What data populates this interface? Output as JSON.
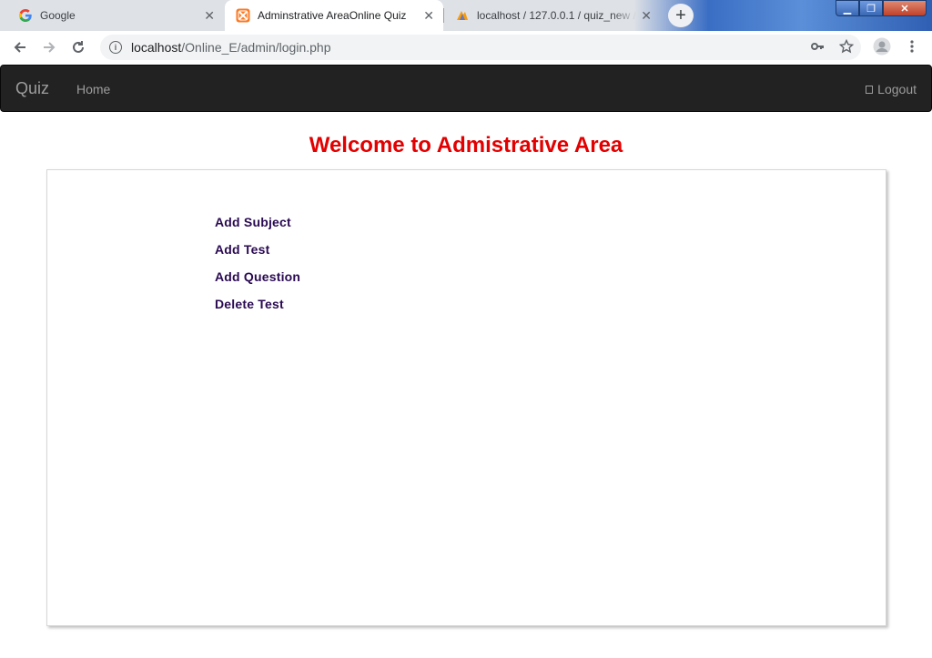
{
  "browser": {
    "tabs": [
      {
        "title": "Google",
        "icon": "google-g-icon"
      },
      {
        "title": "Adminstrative AreaOnline Quiz",
        "icon": "xampp-icon"
      },
      {
        "title": "localhost / 127.0.0.1 / quiz_new / ",
        "icon": "phpmyadmin-icon"
      }
    ],
    "address": {
      "host": "localhost",
      "path": "/Online_E/admin/login.php"
    }
  },
  "navbar": {
    "brand": "Quiz",
    "home": "Home",
    "logout": "Logout"
  },
  "page": {
    "heading": "Welcome to Admistrative Area",
    "links": [
      "Add Subject",
      "Add Test",
      "Add Question",
      "Delete Test"
    ]
  },
  "colors": {
    "heading": "#e30000",
    "navbar": "#222222",
    "link": "#2a0a52"
  }
}
